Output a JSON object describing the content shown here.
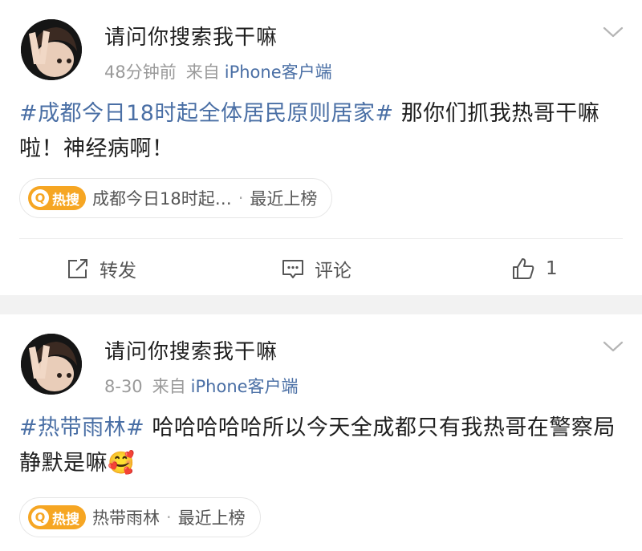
{
  "posts": [
    {
      "username": "请问你搜索我干嘛",
      "time": "48分钟前",
      "source_prefix": "来自",
      "source_client": "iPhone客户端",
      "hashtag": "#成都今日18时起全体居民原则居家#",
      "text": " 那你们抓我热哥干嘛啦！神经病啊！",
      "hot_badge": "热搜",
      "hot_topic": "成都今日18时起…",
      "hot_status": "最近上榜",
      "actions": {
        "share": "转发",
        "comment": "评论",
        "like_count": "1"
      }
    },
    {
      "username": "请问你搜索我干嘛",
      "time": "8-30",
      "source_prefix": "来自",
      "source_client": "iPhone客户端",
      "hashtag": "#热带雨林#",
      "text": " 哈哈哈哈哈所以今天全成都只有我热哥在警察局静默是嘛",
      "emoji": "🥰",
      "hot_badge": "热搜",
      "hot_topic": "热带雨林",
      "hot_status": "最近上榜"
    }
  ],
  "colors": {
    "link": "#4a6fa5",
    "badge": "#f6a623",
    "separator": "#f2f2f2"
  },
  "icons": [
    "chevron-down-icon",
    "share-icon",
    "comment-icon",
    "like-icon",
    "hot-search-icon"
  ]
}
